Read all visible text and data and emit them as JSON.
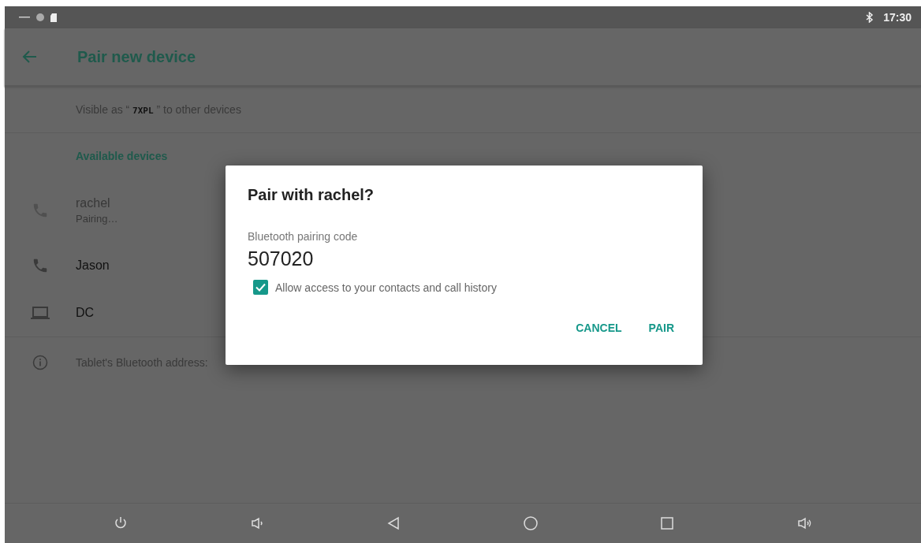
{
  "status_bar": {
    "time": "17:30"
  },
  "toolbar": {
    "title": "Pair new device"
  },
  "visible_as": "Visible as “ **7XPL** ” to other devices",
  "section_title": "Available devices",
  "devices": [
    {
      "kind": "phone",
      "name": "rachel",
      "summary": "Pairing…",
      "disabled": true
    },
    {
      "kind": "phone",
      "name": "Jason",
      "disabled": false
    },
    {
      "kind": "laptop",
      "name": "DC",
      "disabled": false
    }
  ],
  "address_text": "Tablet's Bluetooth address:",
  "dialog": {
    "title": "Pair with rachel?",
    "code_label": "Bluetooth pairing code",
    "code": "507020",
    "checkbox": {
      "label": "Allow access to your contacts and call history",
      "checked": true
    },
    "buttons": [
      "CANCEL",
      "PAIR"
    ]
  },
  "nav_bar": [
    {
      "kind": "power"
    },
    {
      "kind": "volume-down"
    },
    {
      "kind": "back"
    },
    {
      "kind": "home"
    },
    {
      "kind": "recents"
    },
    {
      "kind": "volume-up"
    }
  ]
}
